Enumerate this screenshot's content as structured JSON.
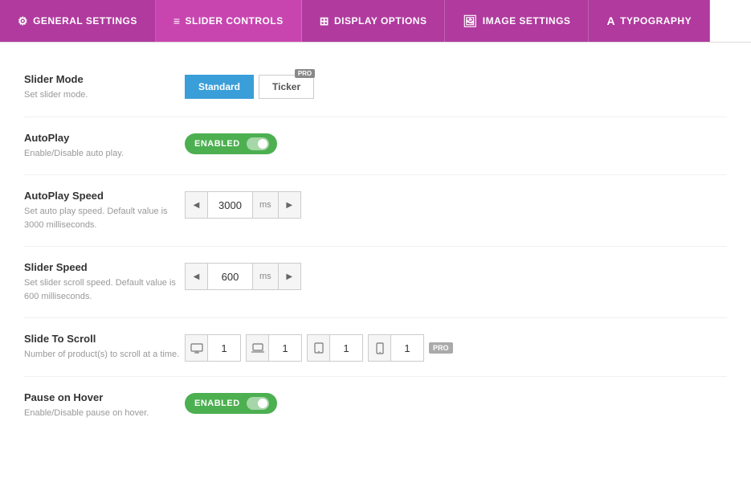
{
  "tabs": [
    {
      "id": "general",
      "label": "GENERAL SETTINGS",
      "icon": "⚙",
      "active": false
    },
    {
      "id": "slider",
      "label": "SLIDER CONTROLS",
      "icon": "≡",
      "active": true
    },
    {
      "id": "display",
      "label": "DISPLAY OPTIONS",
      "icon": "⊞",
      "active": false
    },
    {
      "id": "image",
      "label": "IMAGE SETTINGS",
      "icon": "🖼",
      "active": false
    },
    {
      "id": "typography",
      "label": "TYPOGRAPHY",
      "icon": "A",
      "active": false
    }
  ],
  "settings": [
    {
      "id": "slider-mode",
      "title": "Slider Mode",
      "description": "Set slider mode.",
      "type": "mode-buttons",
      "options": [
        {
          "label": "Standard",
          "selected": true,
          "pro": false
        },
        {
          "label": "Ticker",
          "selected": false,
          "pro": true
        }
      ]
    },
    {
      "id": "autoplay",
      "title": "AutoPlay",
      "description": "Enable/Disable auto play.",
      "type": "toggle",
      "value": "ENABLED",
      "enabled": true
    },
    {
      "id": "autoplay-speed",
      "title": "AutoPlay Speed",
      "description": "Set auto play speed. Default value is 3000 milliseconds.",
      "type": "spinner",
      "value": "3000",
      "unit": "ms"
    },
    {
      "id": "slider-speed",
      "title": "Slider Speed",
      "description": "Set slider scroll speed. Default value is 600 milliseconds.",
      "type": "spinner",
      "value": "600",
      "unit": "ms"
    },
    {
      "id": "slide-to-scroll",
      "title": "Slide To Scroll",
      "description": "Number of product(s) to scroll at a time.",
      "type": "scroll-multi",
      "values": [
        "1",
        "1",
        "1",
        "1"
      ],
      "icons": [
        "🖥",
        "💻",
        "⬜",
        "📱"
      ]
    },
    {
      "id": "pause-on-hover",
      "title": "Pause on Hover",
      "description": "Enable/Disable pause on hover.",
      "type": "toggle",
      "value": "ENABLED",
      "enabled": true
    }
  ],
  "pro_label": "PRO"
}
